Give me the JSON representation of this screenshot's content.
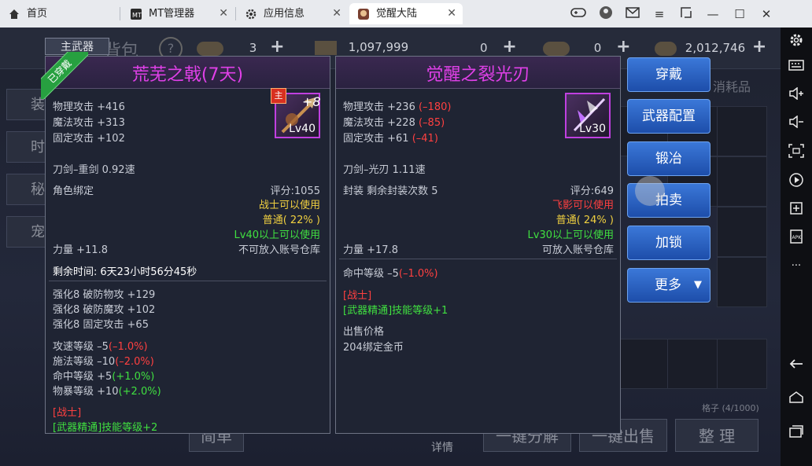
{
  "tabs": [
    {
      "label": "首页"
    },
    {
      "label": "MT管理器"
    },
    {
      "label": "应用信息"
    },
    {
      "label": "觉醒大陆"
    }
  ],
  "background": {
    "bag_title": "背包",
    "help": "?",
    "resources": [
      "3",
      "1,097,999",
      "0",
      "0",
      "2,012,746"
    ],
    "consumables_tab": "消耗品",
    "left_tabs": [
      "装",
      "时",
      "秘",
      "宠"
    ],
    "grid_count": "格子 (4/1000)",
    "bottom_buttons": [
      "简单",
      "一键分解",
      "一键出售",
      "整 理"
    ],
    "details": "详情"
  },
  "slot_tab": "主武器",
  "equipped_label": "已穿戴",
  "item1": {
    "name": "荒芜之戟(7天)",
    "icon_badge": "主",
    "enhance": "+8",
    "level_badge": "Lv40",
    "phys_atk": "物理攻击 +416",
    "mag_atk": "魔法攻击 +313",
    "fixed_atk": "固定攻击 +102",
    "weapon_type": "刀剑–重剑  0.92速",
    "bind": "角色绑定",
    "score": "评分:1055",
    "class_req": "战士可以使用",
    "quality": "普通( 22% )",
    "level_req": "Lv40以上可以使用",
    "strength": "力量 +11.8",
    "storage": "不可放入账号仓库",
    "remaining_label": "剩余时间:",
    "remaining_value": "6天23小时56分45秒",
    "enhance_lines": [
      "强化8 破防物攻 +129",
      "强化8 破防魔攻 +102",
      "强化8 固定攻击 +65"
    ],
    "stats": [
      {
        "base": "攻速等级 –5",
        "delta": "(–1.0%)",
        "delta_color": "#ff4040"
      },
      {
        "base": "施法等级 –10",
        "delta": "(–2.0%)",
        "delta_color": "#ff4040"
      },
      {
        "base": "命中等级 +5",
        "delta": "(+1.0%)",
        "delta_color": "#40e040"
      },
      {
        "base": "物暴等级 +10",
        "delta": "(+2.0%)",
        "delta_color": "#40e040"
      }
    ],
    "class_tag": "[战士]",
    "skill": "[武器精通]技能等级+2"
  },
  "item2": {
    "name": "觉醒之裂光刃",
    "level_badge": "Lv30",
    "phys_atk": "物理攻击 +236",
    "phys_delta": "(–180)",
    "mag_atk": "魔法攻击 +228",
    "mag_delta": "(–85)",
    "fixed_atk": "固定攻击 +61",
    "fixed_delta": "(–41)",
    "weapon_type": "刀剑–光刃  1.11速",
    "seal": "封装 剩余封装次数 5",
    "score": "评分:649",
    "class_req": "飞影可以使用",
    "quality": "普通( 24% )",
    "level_req": "Lv30以上可以使用",
    "strength": "力量 +17.8",
    "storage": "可放入账号仓库",
    "hit_base": "命中等级 –5",
    "hit_delta": "(–1.0%)",
    "class_tag": "[战士]",
    "skill": "[武器精通]技能等级+1",
    "sell_label": "出售价格",
    "sell_value": "204绑定金币"
  },
  "actions": {
    "wear": "穿戴",
    "config": "武器配置",
    "forge": "锻冶",
    "auction": "拍卖",
    "lock": "加锁",
    "more": "更多"
  },
  "colors": {
    "item_name": "#e040e8",
    "red": "#ff4040",
    "green": "#40e040",
    "yellow": "#f0d040",
    "button_blue": "#2a62c4"
  }
}
